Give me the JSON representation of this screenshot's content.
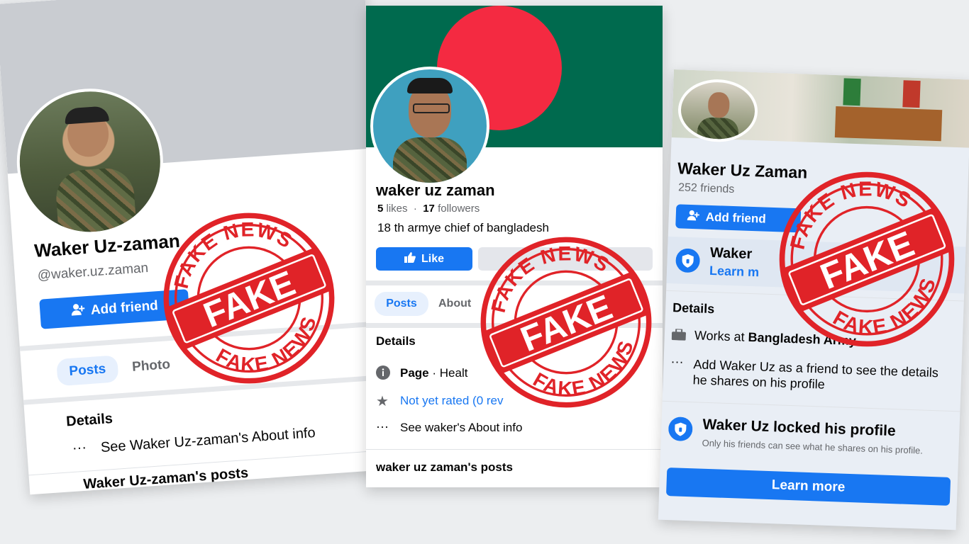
{
  "stamp": {
    "ring_text": "FAKE NEWS",
    "center_text": "FAKE",
    "color": "#e02328"
  },
  "card1": {
    "name": "Waker Uz-zaman",
    "handle": "@waker.uz.zaman",
    "add_friend": "Add friend",
    "tabs": [
      "Posts",
      "Photo"
    ],
    "details_title": "Details",
    "about_row": "See Waker Uz-zaman's About info",
    "posts_heading": "Waker Uz-zaman's posts"
  },
  "card2": {
    "name": "waker uz zaman",
    "likes_count": "5",
    "likes_label": "likes",
    "followers_count": "17",
    "followers_label": "followers",
    "bio": "18 th armye chief of bangladesh",
    "like_button": "Like",
    "tabs": [
      "Posts",
      "About"
    ],
    "details_title": "Details",
    "page_label": "Page",
    "page_category": "· Healt",
    "rating": "Not yet rated (0 rev",
    "about_row": "See waker's About info",
    "posts_heading": "waker uz zaman's posts",
    "flag_green": "#006a4e",
    "flag_red": "#f42a41"
  },
  "card3": {
    "name": "Waker Uz Zaman",
    "friends": "252 friends",
    "add_friend": "Add friend",
    "lock_banner_title": "Waker",
    "lock_banner_link": "Learn m",
    "details_title": "Details",
    "works_at_prefix": "Works at ",
    "works_at_org": "Bangladesh Army",
    "add_hint": "Add Waker Uz as a friend to see the details he shares on his profile",
    "locked_title": "Waker Uz locked his profile",
    "locked_desc": "Only his friends can see what he shares on his profile.",
    "learn_more": "Learn more"
  },
  "brand": {
    "facebook_blue": "#1877f2"
  }
}
